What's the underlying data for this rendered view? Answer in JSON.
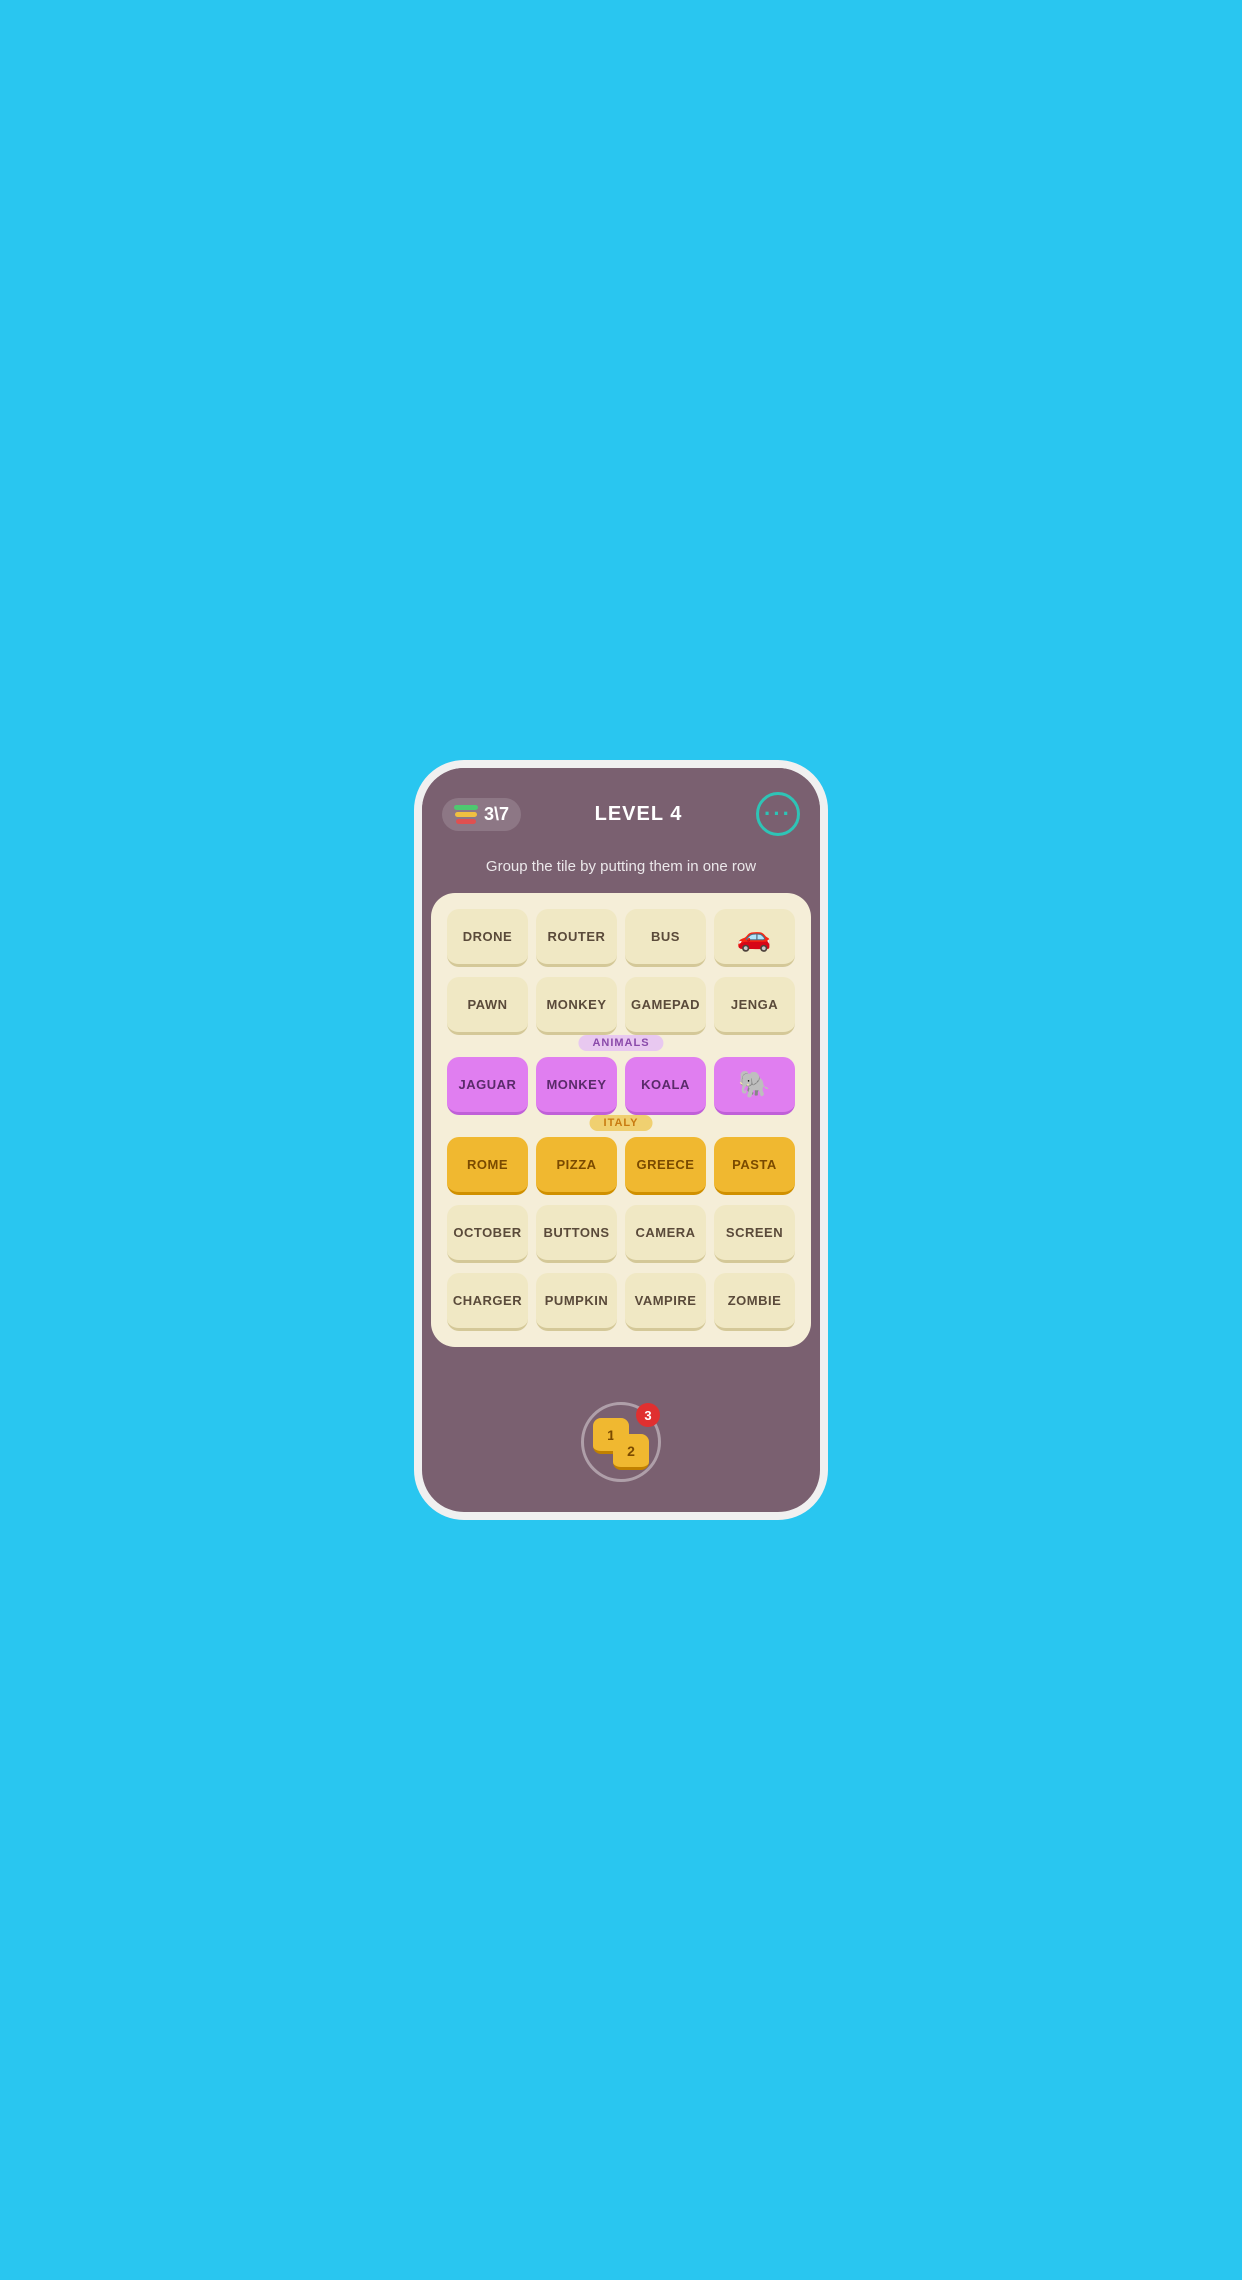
{
  "header": {
    "score": "3\\7",
    "level": "LEVEL 4",
    "menu_dots": "···"
  },
  "subtitle": "Group the tile by putting them in one row",
  "rows": {
    "row1": [
      "DRONE",
      "ROUTER",
      "BUS",
      "🚗"
    ],
    "row2": [
      "PAWN",
      "MONKEY",
      "GAMEPAD",
      "JENGA"
    ],
    "animals_label": "ANIMALS",
    "animals": [
      "JAGUAR",
      "MONKEY",
      "KOALA",
      "🐘"
    ],
    "italy_label": "ITALY",
    "italy": [
      "ROME",
      "PIZZA",
      "GREECE",
      "PASTA"
    ],
    "row5": [
      "OCTOBER",
      "BUTTONS",
      "CAMERA",
      "SCREEN"
    ],
    "row6": [
      "CHARGER",
      "PUMPKIN",
      "VAMPIRE",
      "ZOMBIE"
    ]
  },
  "hint": {
    "tile1": "1",
    "tile2": "2",
    "badge": "3"
  }
}
